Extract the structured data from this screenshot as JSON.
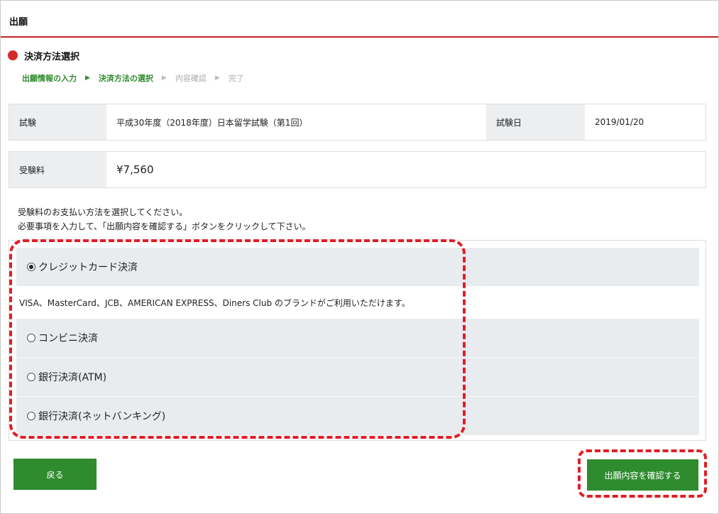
{
  "header": {
    "title": "出願"
  },
  "section": {
    "title": "決済方法選択"
  },
  "steps": [
    {
      "label": "出願情報の入力",
      "state": "done"
    },
    {
      "label": "決済方法の選択",
      "state": "current"
    },
    {
      "label": "内容確認",
      "state": "future"
    },
    {
      "label": "完了",
      "state": "future"
    }
  ],
  "exam": {
    "exam_label": "試験",
    "exam_value": "平成30年度（2018年度）日本留学試験（第1回）",
    "date_label": "試験日",
    "date_value": "2019/01/20"
  },
  "fee": {
    "label": "受験料",
    "value": "¥7,560"
  },
  "instructions": {
    "line1": "受験料のお支払い方法を選択してください。",
    "line2": "必要事項を入力して、「出願内容を確認する」ボタンをクリックして下さい。"
  },
  "payment": {
    "options": [
      {
        "label": "クレジットカード決済",
        "selected": true
      },
      {
        "label": "コンビニ決済",
        "selected": false
      },
      {
        "label": "銀行決済(ATM)",
        "selected": false
      },
      {
        "label": "銀行決済(ネットバンキング)",
        "selected": false
      }
    ],
    "credit_note": "VISA、MasterCard、JCB、AMERICAN EXPRESS、Diners Club のブランドがご利用いただけます。"
  },
  "buttons": {
    "back": "戻る",
    "confirm": "出願内容を確認する"
  },
  "colors": {
    "accent_red": "#cc1f26",
    "button_green": "#2e8b2e",
    "highlight_red": "#e01e26"
  }
}
